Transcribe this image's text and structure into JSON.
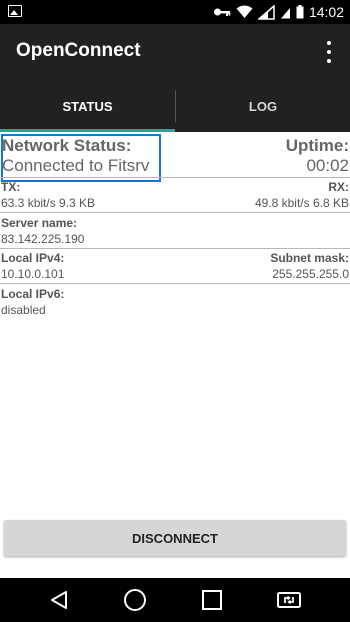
{
  "statusbar": {
    "time": "14:02",
    "icons": [
      "gallery-icon",
      "key-icon",
      "wifi-icon",
      "signal-icon",
      "signal-icon",
      "battery-icon"
    ]
  },
  "appbar": {
    "title": "OpenConnect",
    "menu_icon": "overflow-menu-icon"
  },
  "tabs": [
    {
      "label": "STATUS",
      "selected": true
    },
    {
      "label": "LOG",
      "selected": false
    }
  ],
  "status": {
    "network_status_label": "Network Status:",
    "network_status_value": "Connected to Fitsrv",
    "uptime_label": "Uptime:",
    "uptime_value": "00:02",
    "tx_label": "TX:",
    "tx_value": "63.3 kbit/s 9.3 KB",
    "rx_label": "RX:",
    "rx_value": "49.8 kbit/s 6.8 KB",
    "server_name_label": "Server name:",
    "server_name_value": "83.142.225.190",
    "local_ipv4_label": "Local IPv4:",
    "local_ipv4_value": "10.10.0.101",
    "subnet_mask_label": "Subnet mask:",
    "subnet_mask_value": "255.255.255.0",
    "local_ipv6_label": "Local IPv6:",
    "local_ipv6_value": "disabled"
  },
  "actions": {
    "disconnect_label": "DISCONNECT"
  },
  "navbar": {
    "icons": [
      "back-icon",
      "home-icon",
      "recents-icon",
      "screen-cast-icon"
    ]
  },
  "colors": {
    "appbar": "#212121",
    "tab_indicator": "#26a69a",
    "highlight": "#1a73d9"
  }
}
